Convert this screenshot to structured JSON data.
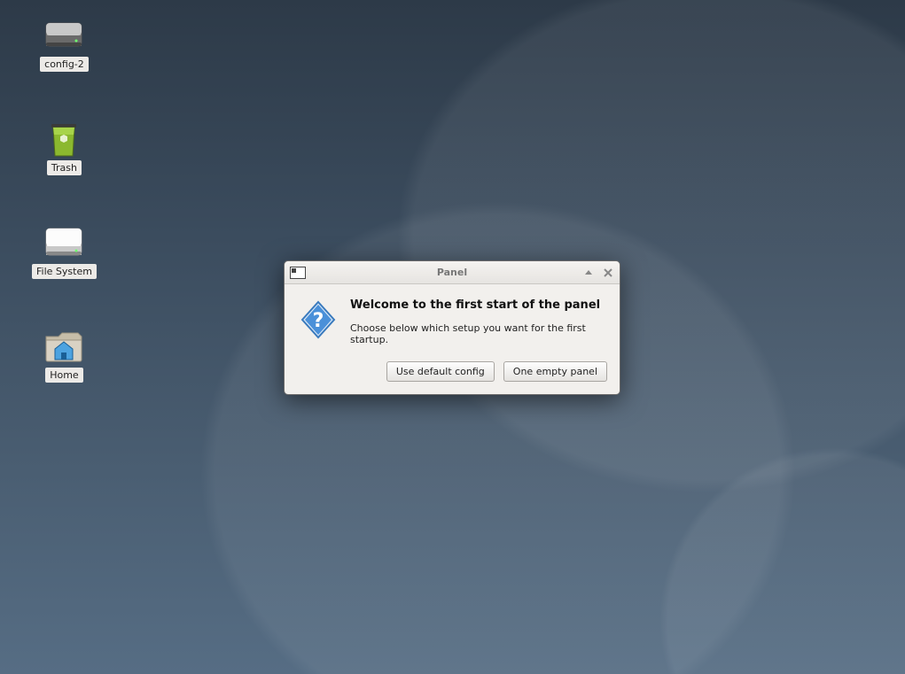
{
  "desktop": {
    "icons": [
      {
        "id": "config-2",
        "label": "config-2",
        "kind": "drive"
      },
      {
        "id": "trash",
        "label": "Trash",
        "kind": "trash"
      },
      {
        "id": "file-system",
        "label": "File System",
        "kind": "filesystem"
      },
      {
        "id": "home",
        "label": "Home",
        "kind": "home"
      }
    ]
  },
  "dialog": {
    "title": "Panel",
    "heading": "Welcome to the first start of the panel",
    "subtext": "Choose below which setup you want for the first startup.",
    "buttons": {
      "default_config": "Use default config",
      "empty_panel": "One empty panel"
    }
  }
}
